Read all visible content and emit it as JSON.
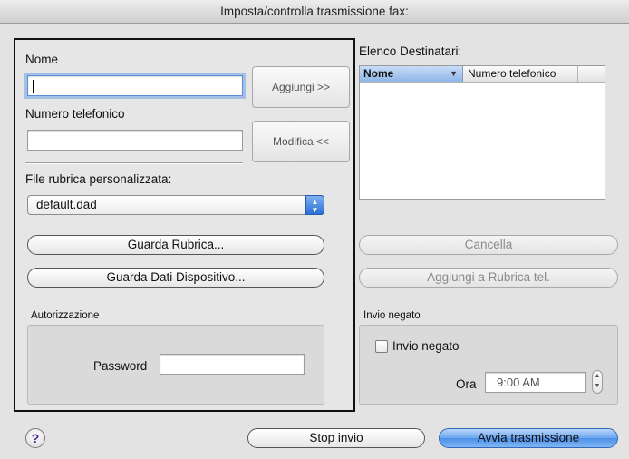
{
  "window": {
    "title": "Imposta/controlla trasmissione fax:"
  },
  "left": {
    "name_label": "Nome",
    "name_value": "",
    "phone_label": "Numero telefonico",
    "phone_value": "",
    "add_button": "Aggiungi >>",
    "modify_button": "Modifica <<",
    "phonebook_file_label": "File rubrica personalizzata:",
    "phonebook_file_value": "default.dad",
    "view_phonebook_button": "Guarda Rubrica...",
    "view_device_data_button": "Guarda Dati Dispositivo...",
    "authorization": {
      "title": "Autorizzazione",
      "password_label": "Password",
      "password_value": ""
    }
  },
  "right": {
    "recipients_label": "Elenco Destinatari:",
    "columns": [
      "Nome",
      "Numero telefonico"
    ],
    "sort_arrow": "▼",
    "delete_button": "Cancella",
    "add_to_phonebook_button": "Aggiungi a Rubrica tel.",
    "deny": {
      "title": "Invio negato",
      "checkbox_label": "Invio negato",
      "checked": false,
      "time_label": "Ora",
      "time_value": "9:00 AM"
    }
  },
  "footer": {
    "help": "?",
    "stop_button": "Stop invio",
    "start_button": "Avvia trasmissione"
  },
  "icons": {
    "popup_arrows": "up-down-arrows-icon",
    "stepper": "stepper-arrows-icon",
    "help": "help-icon"
  },
  "colors": {
    "accent": "#4b90e8",
    "focus_ring": "#6ea0e6"
  }
}
